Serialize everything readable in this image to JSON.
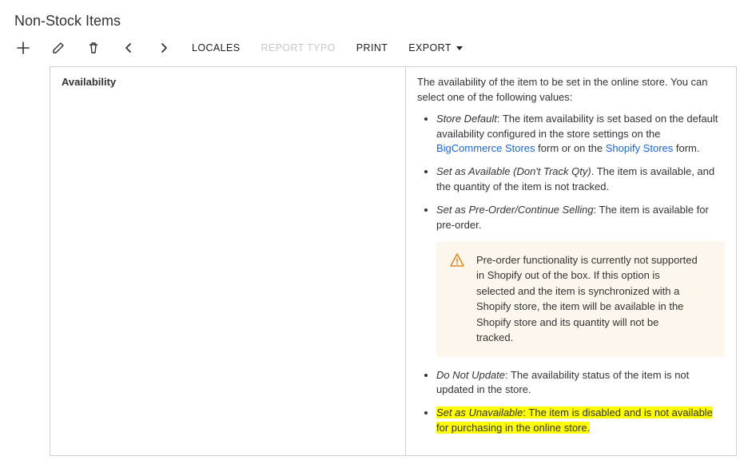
{
  "page": {
    "title": "Non-Stock Items"
  },
  "toolbar": {
    "locales": "LOCALES",
    "report_typo": "REPORT TYPO",
    "print": "PRINT",
    "export": "EXPORT"
  },
  "section": {
    "heading": "Availability",
    "intro": "The availability of the item to be set in the online store. You can select one of the following values:",
    "items": {
      "store_default": {
        "label": "Store Default",
        "text_before_link1": ": The item availability is set based on the default availability configured in the store settings on the ",
        "link1": "BigCommerce Stores",
        "mid": " form or on the ",
        "link2": "Shopify Stores",
        "after": " form."
      },
      "set_available": {
        "label": "Set as Available (Don't Track Qty)",
        "text": ". The item is available, and the quantity of the item is not tracked."
      },
      "set_preorder": {
        "label": "Set as Pre-Order/Continue Selling",
        "text": ": The item is available for pre-order."
      },
      "warning": "Pre-order functionality is currently not supported in Shopify out of the box. If this option is selected and the item is synchronized with a Shopify store, the item will be available in the Shopify store and its quantity will not be tracked.",
      "do_not_update": {
        "label": "Do Not Update",
        "text": ": The availability status of the item is not updated in the store."
      },
      "set_unavailable": {
        "label": "Set as Unavailable",
        "text": ": The item is disabled and is not available for purchasing in the online store."
      }
    }
  }
}
